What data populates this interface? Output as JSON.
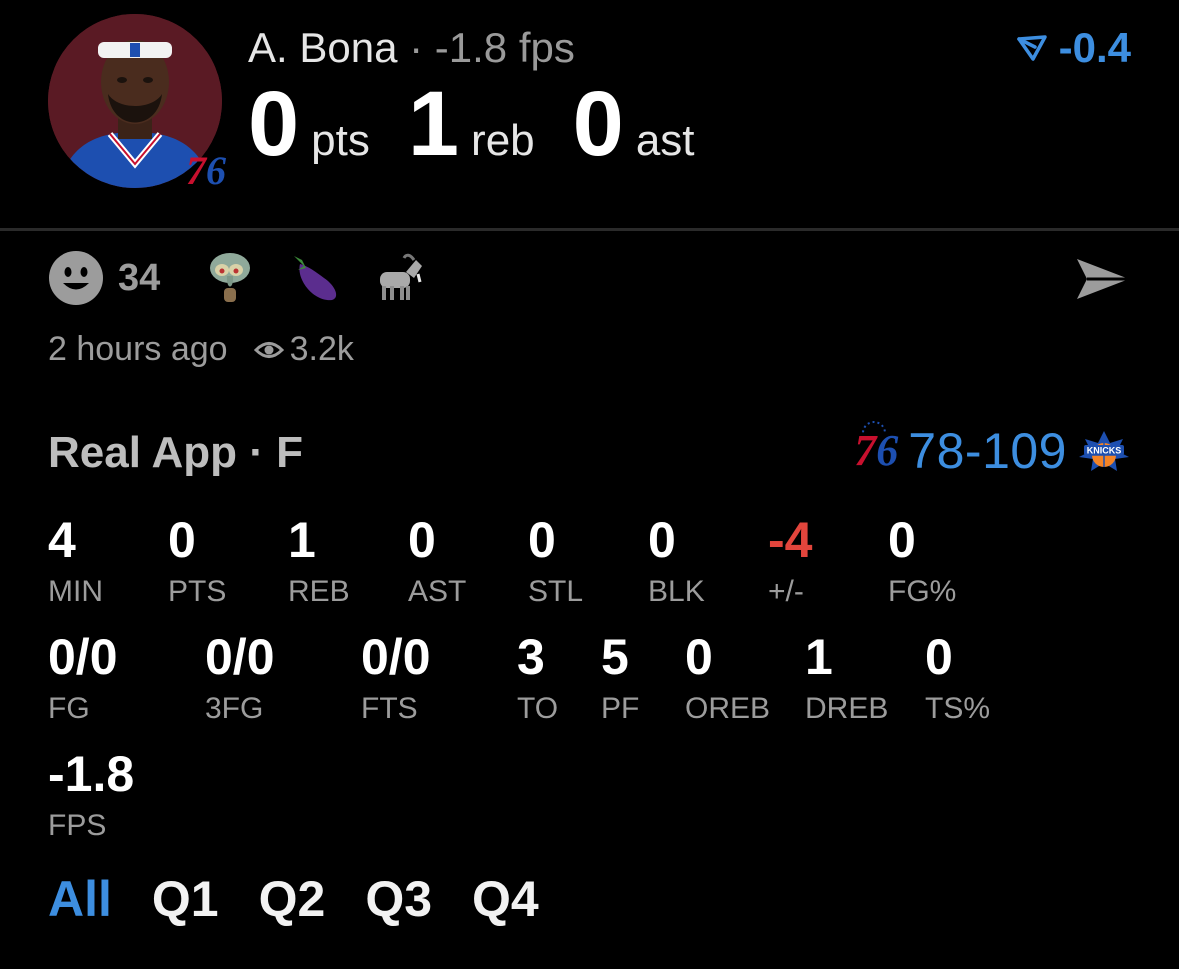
{
  "header": {
    "player_name": "A. Bona",
    "separator": "·",
    "fps_label": "-1.8 fps",
    "trend_value": "-0.4",
    "team_badge": "76",
    "stats": [
      {
        "value": "0",
        "unit": "pts"
      },
      {
        "value": "1",
        "unit": "reb"
      },
      {
        "value": "0",
        "unit": "ast"
      }
    ]
  },
  "reactions": {
    "count": "34",
    "emojis": [
      "smiley-face-icon",
      "squidward-icon",
      "eggplant-icon",
      "goat-icon"
    ]
  },
  "meta": {
    "time_ago": "2 hours ago",
    "views": "3.2k"
  },
  "game": {
    "title": "Real App · F",
    "home_logo": "76",
    "score": "78-109",
    "away_logo": "KNICKS"
  },
  "stats_row1": [
    {
      "value": "4",
      "label": "MIN"
    },
    {
      "value": "0",
      "label": "PTS"
    },
    {
      "value": "1",
      "label": "REB"
    },
    {
      "value": "0",
      "label": "AST"
    },
    {
      "value": "0",
      "label": "STL"
    },
    {
      "value": "0",
      "label": "BLK"
    },
    {
      "value": "-4",
      "label": "+/-"
    },
    {
      "value": "0",
      "label": "FG%"
    }
  ],
  "stats_row2": [
    {
      "value": "0/0",
      "label": "FG"
    },
    {
      "value": "0/0",
      "label": "3FG"
    },
    {
      "value": "0/0",
      "label": "FTS"
    },
    {
      "value": "3",
      "label": "TO"
    },
    {
      "value": "5",
      "label": "PF"
    },
    {
      "value": "0",
      "label": "OREB"
    },
    {
      "value": "1",
      "label": "DREB"
    },
    {
      "value": "0",
      "label": "TS%"
    }
  ],
  "stats_row3": [
    {
      "value": "-1.8",
      "label": "FPS"
    }
  ],
  "tabs": [
    "All",
    "Q1",
    "Q2",
    "Q3",
    "Q4"
  ],
  "colors": {
    "accent": "#3d8ee0",
    "negative": "#e2453c",
    "muted": "#9c9c9c",
    "background": "#000000"
  }
}
